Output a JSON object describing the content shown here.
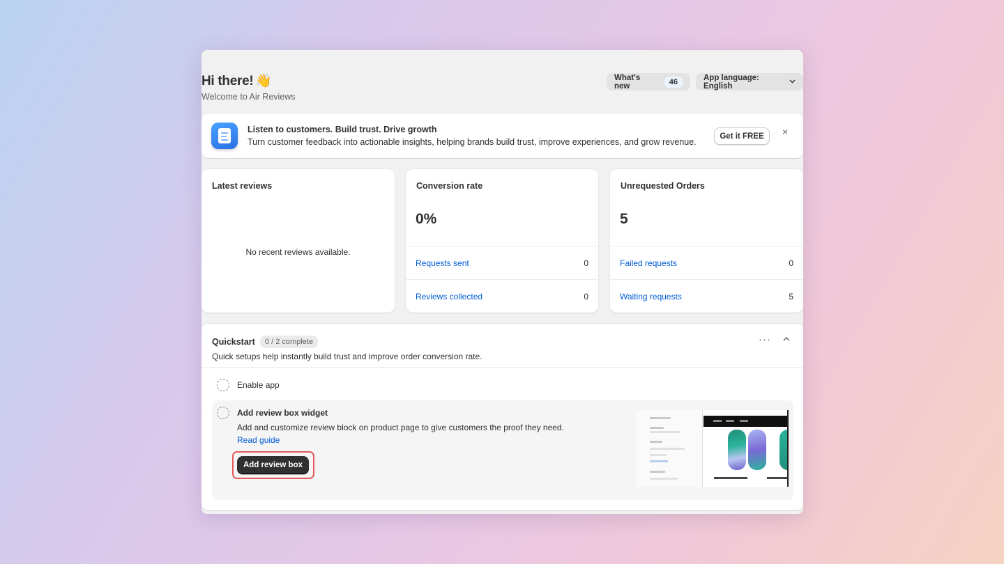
{
  "header": {
    "greeting": "Hi there!",
    "wave": "👋",
    "subtitle": "Welcome to Air Reviews",
    "whats_new_label": "What's new",
    "whats_new_count": "46",
    "language_label": "App language: English",
    "language_chevron": "⌄"
  },
  "banner": {
    "title": "Listen to customers. Build trust. Drive growth",
    "description": "Turn customer feedback into actionable insights, helping brands build trust, improve experiences, and grow revenue.",
    "cta_label": "Get it FREE",
    "close_glyph": "×"
  },
  "latest_reviews": {
    "label": "Latest reviews",
    "empty_text": "No recent reviews available."
  },
  "conversion": {
    "label": "Conversion rate",
    "value": "0%",
    "rows": [
      {
        "label": "Requests sent",
        "value": "0"
      },
      {
        "label": "Reviews collected",
        "value": "0"
      }
    ]
  },
  "unrequested": {
    "label": "Unrequested Orders",
    "value": "5",
    "rows": [
      {
        "label": "Failed requests",
        "value": "0"
      },
      {
        "label": "Waiting requests",
        "value": "5"
      }
    ]
  },
  "quickstart": {
    "title": "Quickstart",
    "progress": "0 / 2 complete",
    "description": "Quick setups help instantly build trust and improve order conversion rate.",
    "menu_glyph": "···",
    "collapse_glyph": "︿",
    "steps": [
      {
        "title": "Enable app"
      },
      {
        "title": "Add review box widget",
        "description": "Add and customize review block on product page to give customers the proof they need.",
        "link": "Read guide",
        "button": "Add review box"
      }
    ]
  },
  "colors": {
    "link": "#005bd3",
    "primary_button": "#303030",
    "highlight": "#e45a5a"
  },
  "icons": [
    "app-logo-icon",
    "close-icon",
    "chevron-down-icon",
    "more-icon",
    "chevron-up-icon",
    "dashed-circle-icon"
  ]
}
